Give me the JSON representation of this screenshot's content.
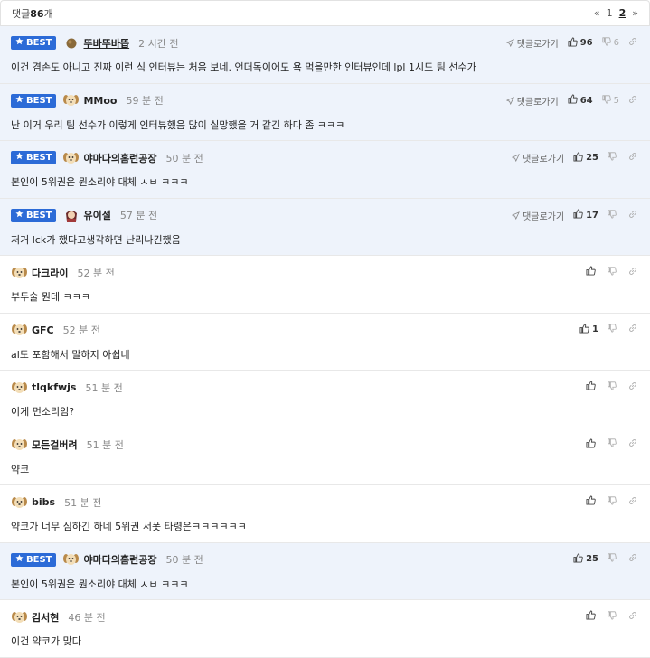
{
  "header": {
    "count_prefix": "댓글",
    "count": "86",
    "count_suffix": "개",
    "prev": "«",
    "pages": [
      "1",
      "2"
    ],
    "current_page": "2",
    "next": "»"
  },
  "labels": {
    "best": "BEST",
    "reply": "댓글로가기"
  },
  "icons": {
    "star": "star-icon",
    "send": "send-icon",
    "thumbs_up": "thumbs-up-icon",
    "thumbs_down": "thumbs-down-icon",
    "link": "link-icon"
  },
  "colors": {
    "best_bg": "#eef3fb",
    "badge": "#2c6bd7"
  },
  "comments": [
    {
      "best": true,
      "nick": "뚜바뚜바뜹",
      "avatar": "ball",
      "nick_underline": true,
      "time": "2 시간 전",
      "reply": true,
      "up": "96",
      "down": "6",
      "text": "이건 겸손도 아니고 진짜 이런 식 인터뷰는 처음 보네. 언더독이어도 욕 먹을만한 인터뷰인데 lpl 1시드 팀 선수가"
    },
    {
      "best": true,
      "nick": "MMoo",
      "avatar": "dog",
      "time": "59 분 전",
      "reply": true,
      "up": "64",
      "down": "5",
      "text": "난 이거 우리 팀 선수가 이렇게 인터뷰했음 많이 실망했을 거 같긴 하다 좀 ㅋㅋㅋ"
    },
    {
      "best": true,
      "nick": "야마다의홈런공장",
      "avatar": "dog",
      "time": "50 분 전",
      "reply": true,
      "up": "25",
      "down": "",
      "text": "본인이 5위권은 뭔소리야 대체 ㅅㅂ ㅋㅋㅋ"
    },
    {
      "best": true,
      "nick": "유이설",
      "avatar": "char",
      "time": "57 분 전",
      "reply": true,
      "up": "17",
      "down": "",
      "text": "저거 lck가 했다고생각하면 난리나긴했음"
    },
    {
      "best": false,
      "nick": "다크라이",
      "avatar": "dog",
      "time": "52 분 전",
      "reply": false,
      "up": "",
      "down": "",
      "text": "부두술 뭔데 ㅋㅋㅋ"
    },
    {
      "best": false,
      "nick": "GFC",
      "avatar": "dog",
      "time": "52 분 전",
      "reply": false,
      "up": "1",
      "down": "",
      "text": "al도 포함해서 말하지 아쉽네"
    },
    {
      "best": false,
      "nick": "tlqkfwjs",
      "avatar": "dog",
      "time": "51 분 전",
      "reply": false,
      "up": "",
      "down": "",
      "text": "이게 먼소리임?"
    },
    {
      "best": false,
      "nick": "모든걸버려",
      "avatar": "dog",
      "time": "51 분 전",
      "reply": false,
      "up": "",
      "down": "",
      "text": "약코"
    },
    {
      "best": false,
      "nick": "bibs",
      "avatar": "dog",
      "time": "51 분 전",
      "reply": false,
      "up": "",
      "down": "",
      "text": "약코가 너무 심하긴 하네 5위권 서폿 타령은ㅋㅋㅋㅋㅋㅋ"
    },
    {
      "best": true,
      "nick": "야마다의홈런공장",
      "avatar": "dog",
      "time": "50 분 전",
      "reply": false,
      "up": "25",
      "down": "",
      "text": "본인이 5위권은 뭔소리야 대체 ㅅㅂ ㅋㅋㅋ"
    },
    {
      "best": false,
      "nick": "김서현",
      "avatar": "dog",
      "time": "46 분 전",
      "reply": false,
      "up": "",
      "down": "",
      "text": "이건 약코가 맞다"
    }
  ]
}
